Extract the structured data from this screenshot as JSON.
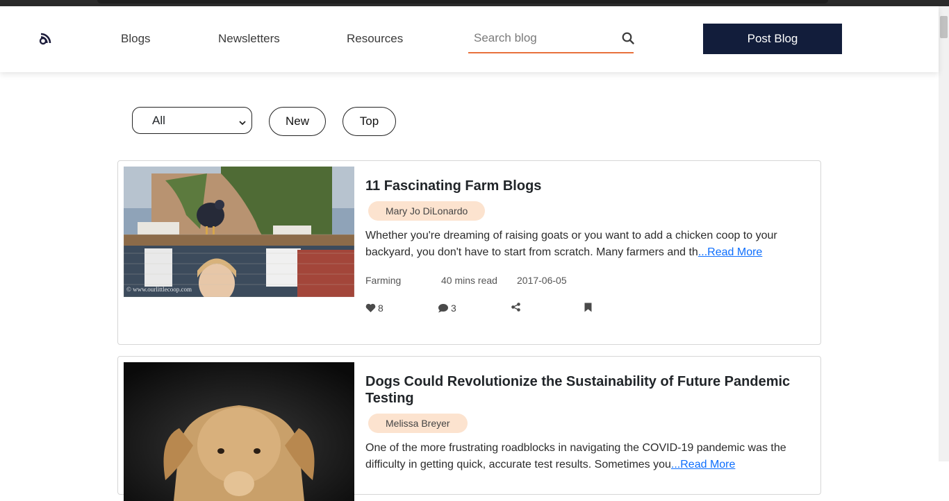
{
  "nav": {
    "links": [
      "Blogs",
      "Newsletters",
      "Resources"
    ],
    "search_placeholder": "Search blog",
    "post_button": "Post Blog"
  },
  "filters": {
    "selected": "All",
    "new_label": "New",
    "top_label": "Top"
  },
  "posts": [
    {
      "title": "11 Fascinating Farm Blogs",
      "author": "Mary Jo DiLonardo",
      "excerpt": "Whether you're dreaming of raising goats or you want to add a chicken coop to your backyard, you don't have to start from scratch. Many farmers and th",
      "read_more": "...Read More",
      "category": "Farming",
      "read_time": "40 mins read",
      "date": "2017-06-05",
      "likes": "8",
      "comments": "3",
      "image_watermark": "© www.ourlittlecoop.com"
    },
    {
      "title": "Dogs Could Revolutionize the Sustainability of Future Pandemic Testing",
      "author": "Melissa Breyer",
      "excerpt": "One of the more frustrating roadblocks in navigating the COVID-19 pandemic was the difficulty in getting quick, accurate test results. Sometimes you",
      "read_more": "...Read More"
    }
  ],
  "colors": {
    "accent": "#e8703b",
    "primary_button": "#121d3b",
    "author_badge": "#fce3cf",
    "link": "#0d6efd"
  }
}
